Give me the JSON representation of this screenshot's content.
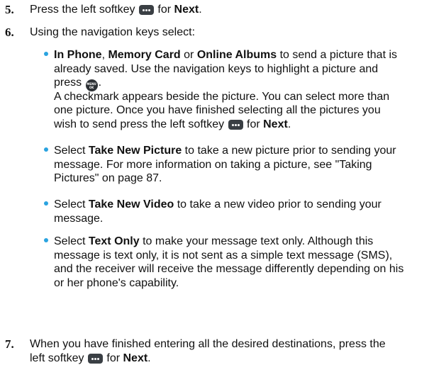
{
  "steps": [
    {
      "number": "5.",
      "lines": [
        [
          "Press the left softkey ",
          {
            "icon": "softkey-icon"
          },
          " for ",
          {
            "b": "Next"
          },
          "."
        ]
      ]
    },
    {
      "number": "6.",
      "lines": [
        [
          "Using the navigation keys select:"
        ]
      ],
      "bullets": [
        {
          "lines": [
            [
              {
                "b": "In Phone"
              },
              ", ",
              {
                "b": "Memory Card"
              },
              " or ",
              {
                "b": "Online Albums"
              },
              " to send a picture that is"
            ],
            [
              "already saved. Use the navigation keys to highlight a picture and"
            ],
            [
              "press ",
              {
                "icon": "menu-ok-icon"
              },
              "."
            ],
            [
              "A checkmark appears beside the picture. You can select more than"
            ],
            [
              "one picture. Once you have finished selecting all the pictures you"
            ],
            [
              "wish to send press the left softkey ",
              {
                "icon": "softkey-icon"
              },
              " for ",
              {
                "b": "Next"
              },
              "."
            ]
          ]
        },
        {
          "lines": [
            [
              "Select ",
              {
                "b": "Take New Picture"
              },
              " to take a new picture prior to sending your"
            ],
            [
              "message. For more information on taking a picture, see \"Taking"
            ],
            [
              "Pictures\" on page 87."
            ]
          ]
        },
        {
          "lines": [
            [
              " Select ",
              {
                "b": "Take New Video"
              },
              " to take a new video prior to sending your"
            ],
            [
              "message."
            ]
          ]
        },
        {
          "lines": [
            [
              "Select ",
              {
                "b": "Text Only"
              },
              " to make your message text only. Although this"
            ],
            [
              "message is text only, it is not sent as a simple text message (SMS),"
            ],
            [
              "and the receiver will receive the message differently depending on his"
            ],
            [
              "or her phone's capability."
            ]
          ]
        }
      ]
    },
    {
      "number": "7.",
      "lines": [
        [
          "When you have finished entering all the desired destinations, press the"
        ],
        [
          "left softkey ",
          {
            "icon": "softkey-icon"
          },
          " for ",
          {
            "b": "Next"
          },
          "."
        ]
      ]
    }
  ],
  "icons": {
    "softkey-icon": "three white dots on dark rounded key",
    "menu-ok-icon": "round key labelled MENU OK"
  },
  "okkey_label_top": "MENU",
  "okkey_label_bottom": "OK",
  "colors": {
    "bullet": "#2aa3e0",
    "text": "#111111"
  }
}
